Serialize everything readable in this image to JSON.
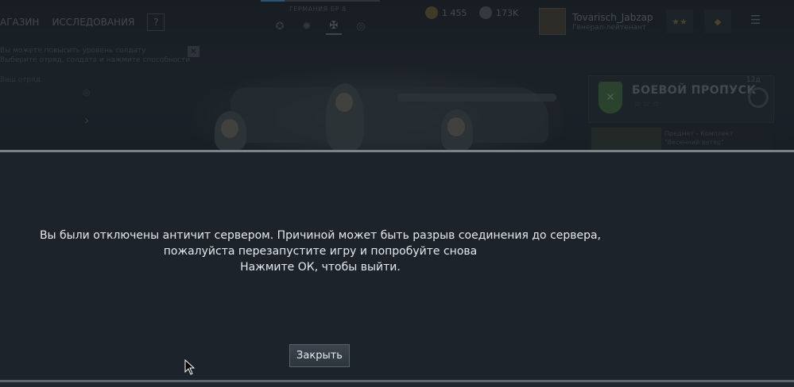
{
  "background": {
    "nav": {
      "shop": "АГАЗИН",
      "research": "ИССЛЕДОВАНИЯ",
      "help": "?"
    },
    "nation_label": "ГЕРМАНИЯ БР 8",
    "currency": {
      "silver": "1 455",
      "gold": "173K"
    },
    "player": {
      "name": "Tovarisch_Jabzap",
      "rank": "Генерал-лейтенант"
    },
    "notice": {
      "line1": "Вы можете повысить уровень солдату",
      "line2": "Выберите отряд, солдата и нажмите способности",
      "close": "✕"
    },
    "side_label": "Ваш отряд",
    "battle_pass": {
      "title": "БОЕВОЙ ПРОПУСК",
      "stars": "☆☆☆",
      "time": "12д",
      "sub_line1": "Предмет - Комплект",
      "sub_line2": "\"Весенний ветер\""
    }
  },
  "dialog": {
    "message_line1": "Вы были отключены античит сервером. Причиной может быть разрыв соединения до сервера,",
    "message_line2": "пожалуйста перезапустите игру и попробуйте снова",
    "message_line3": "Нажмите ОК, чтобы выйти.",
    "close_label": "Закрыть"
  },
  "colors": {
    "overlay": "#1c232b",
    "accent_rule": "#7a828a",
    "text": "#e6e9ec"
  }
}
